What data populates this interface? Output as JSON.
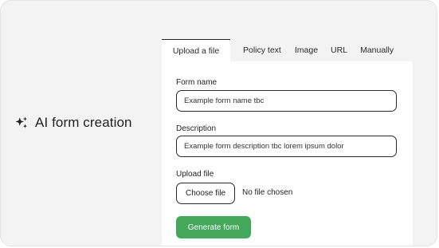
{
  "brand": {
    "title": "AI form creation",
    "icon": "sparkles-icon"
  },
  "tabs": [
    {
      "label": "Upload a file",
      "active": true
    },
    {
      "label": "Policy text",
      "active": false
    },
    {
      "label": "Image",
      "active": false
    },
    {
      "label": "URL",
      "active": false
    },
    {
      "label": "Manually",
      "active": false
    }
  ],
  "form": {
    "form_name_label": "Form name",
    "form_name_value": "Example form name tbc",
    "description_label": "Description",
    "description_value": "Example form description tbc lorem ipsum dolor",
    "upload_label": "Upload file",
    "choose_file_label": "Choose file",
    "file_status": "No file chosen",
    "generate_label": "Generate form"
  },
  "colors": {
    "accent_green": "#43a85a",
    "background": "#f3f3f3",
    "panel": "#ffffff"
  }
}
